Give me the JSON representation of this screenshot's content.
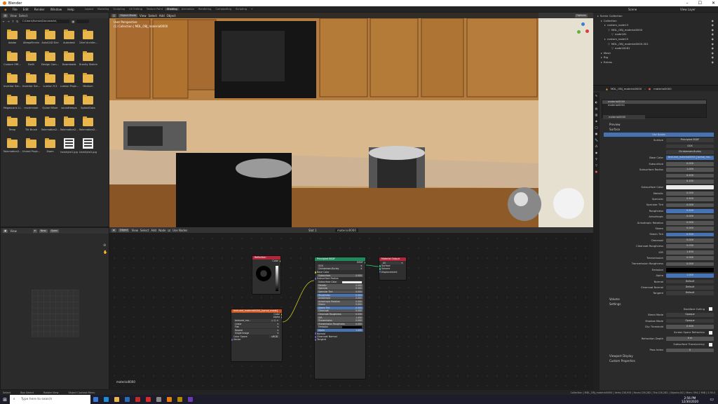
{
  "app": {
    "title": "Blender"
  },
  "menu": [
    "File",
    "Edit",
    "Render",
    "Window",
    "Help"
  ],
  "workspace_tabs": [
    "Layout",
    "Modeling",
    "Sculpting",
    "UV Editing",
    "Texture Paint",
    "Shading",
    "Animation",
    "Rendering",
    "Compositing",
    "Scripting"
  ],
  "active_workspace": "Shading",
  "scene": {
    "label": "Scene",
    "view_layer": "View Layer"
  },
  "file_browser": {
    "header": [
      "View",
      "Select"
    ],
    "path": "C:\\Users\\Human\\Documents\\",
    "items": [
      {
        "name": "Adobe",
        "kind": "folder"
      },
      {
        "name": "AlteqoFinmix",
        "kind": "folder"
      },
      {
        "name": "AutoCAD Dev",
        "kind": "folder"
      },
      {
        "name": "Autodesk",
        "kind": "folder"
      },
      {
        "name": "Chief Archite...",
        "kind": "folder"
      },
      {
        "name": "",
        "kind": "folder"
      },
      {
        "name": "Custom Offi...",
        "kind": "folder"
      },
      {
        "name": "Dalih",
        "kind": "folder"
      },
      {
        "name": "Design Com...",
        "kind": "folder"
      },
      {
        "name": "Downloads",
        "kind": "folder"
      },
      {
        "name": "Dravity Sketch",
        "kind": "folder"
      },
      {
        "name": "",
        "kind": "folder"
      },
      {
        "name": "Inventor Ser...",
        "kind": "folder"
      },
      {
        "name": "Inventor Ser...",
        "kind": "folder"
      },
      {
        "name": "Lumion 9.5",
        "kind": "folder"
      },
      {
        "name": "Lumion Proje...",
        "kind": "folder"
      },
      {
        "name": "Medium",
        "kind": "folder"
      },
      {
        "name": "",
        "kind": "folder"
      },
      {
        "name": "Megascans Li...",
        "kind": "folder"
      },
      {
        "name": "mushmixer",
        "kind": "folder"
      },
      {
        "name": "Quixel Mixer",
        "kind": "folder"
      },
      {
        "name": "soundtemps",
        "kind": "folder"
      },
      {
        "name": "SplashData",
        "kind": "folder"
      },
      {
        "name": "",
        "kind": "folder"
      },
      {
        "name": "Temp",
        "kind": "folder"
      },
      {
        "name": "Tilt Brush",
        "kind": "folder"
      },
      {
        "name": "Twinmotion2...",
        "kind": "folder"
      },
      {
        "name": "Twinmotion2...",
        "kind": "folder"
      },
      {
        "name": "Twinmotion2...",
        "kind": "folder"
      },
      {
        "name": "",
        "kind": "folder"
      },
      {
        "name": "Twinmotion2...",
        "kind": "folder"
      },
      {
        "name": "Unreal Proje...",
        "kind": "folder"
      },
      {
        "name": "Zoom",
        "kind": "folder"
      },
      {
        "name": "hamilyte1.jpg",
        "kind": "image"
      },
      {
        "name": "hamilyte2.jpg",
        "kind": "image"
      },
      {
        "name": "",
        "kind": "none"
      }
    ]
  },
  "image_editor": {
    "header": [
      "View"
    ],
    "buttons": [
      "New",
      "Open"
    ]
  },
  "viewport": {
    "header": [
      "Object Mode",
      "View",
      "Select",
      "Add",
      "Object"
    ],
    "info_line1": "User Perspective",
    "info_line2": "(1) Collection | MDL_OBJ_material0000",
    "options_label": "Options"
  },
  "node_editor": {
    "header": [
      "Object",
      "View",
      "Select",
      "Add",
      "Node",
      "Use Nodes"
    ],
    "slot": "Slot 1",
    "material": "material0000",
    "bottom_label": "material0000",
    "nodes": {
      "refraction": {
        "title": "Reflection",
        "out": "Color"
      },
      "image": {
        "title": "textured_material0000_[sprsql_mode]",
        "outs": [
          "Color",
          "Alpha"
        ],
        "file": "textured_ma...",
        "rows": [
          "Linear",
          "Flat",
          "Repeat",
          "Single Image"
        ],
        "color_space_label": "Color Space",
        "color_space": "sRGB",
        "vector": "Vector"
      },
      "bsdf": {
        "title": "Principled BSDF",
        "out": "BSDF",
        "dist": "GGX",
        "sss": "Christensen-Burley",
        "rows": [
          {
            "label": "Base Color",
            "value": "",
            "style": "socket"
          },
          {
            "label": "Subsurface",
            "value": "0.000",
            "style": "slider"
          },
          {
            "label": "Subsurface Radius",
            "value": "",
            "style": "socket"
          },
          {
            "label": "Subsurface Color",
            "value": "",
            "style": "white"
          },
          {
            "label": "Metallic",
            "value": "0.000",
            "style": "slider"
          },
          {
            "label": "Specular",
            "value": "0.500",
            "style": "slider"
          },
          {
            "label": "Specular Tint",
            "value": "0.000",
            "style": "slider"
          },
          {
            "label": "Roughness",
            "value": "0.500",
            "style": "blue"
          },
          {
            "label": "Anisotropic",
            "value": "0.000",
            "style": "slider"
          },
          {
            "label": "Anisotropic Rotation",
            "value": "0.000",
            "style": "slider"
          },
          {
            "label": "Sheen",
            "value": "0.000",
            "style": "slider"
          },
          {
            "label": "Sheen Tint",
            "value": "0.500",
            "style": "blue"
          },
          {
            "label": "Clearcoat",
            "value": "0.000",
            "style": "slider"
          },
          {
            "label": "Clearcoat Roughness",
            "value": "0.030",
            "style": "slider"
          },
          {
            "label": "IOR",
            "value": "1.450",
            "style": "slider"
          },
          {
            "label": "Transmission",
            "value": "0.000",
            "style": "slider"
          },
          {
            "label": "Transmission Roughness",
            "value": "0.000",
            "style": "slider"
          },
          {
            "label": "Emission",
            "value": "",
            "style": "black"
          },
          {
            "label": "Alpha",
            "value": "1.000",
            "style": "blue"
          },
          {
            "label": "Normal",
            "value": "",
            "style": "socket"
          },
          {
            "label": "Clearcoat Normal",
            "value": "",
            "style": "socket"
          },
          {
            "label": "Tangent",
            "value": "",
            "style": "socket"
          }
        ]
      },
      "output": {
        "title": "Material Output",
        "target": "All",
        "ins": [
          "Surface",
          "Volume",
          "Displacement"
        ]
      }
    }
  },
  "outliner": {
    "rows": [
      {
        "label": "Scene Collection",
        "indent": 0
      },
      {
        "label": "Collection",
        "indent": 1
      },
      {
        "label": "custom_node13",
        "indent": 2
      },
      {
        "label": "MDL_OBJ_material0000",
        "indent": 3
      },
      {
        "label": "node161",
        "indent": 4
      },
      {
        "label": "custom_node15",
        "indent": 2
      },
      {
        "label": "MDL_OBJ_material0000.001",
        "indent": 3
      },
      {
        "label": "node18181",
        "indent": 4
      },
      {
        "label": "Mesh",
        "indent": 1
      },
      {
        "label": "Rig",
        "indent": 1
      },
      {
        "label": "Extras",
        "indent": 1
      }
    ]
  },
  "properties": {
    "object": "MDL_OBJ_material0000",
    "material_tab": "material0000",
    "slots": [
      "material0000",
      "material0001"
    ],
    "material_field": "material0000",
    "sections": {
      "preview": "Preview",
      "surface": "Surface",
      "volume": "Volume",
      "settings": "Settings",
      "viewport_display": "Viewport Display",
      "custom_props": "Custom Properties"
    },
    "use_nodes": "Use Nodes",
    "surface_label": "Surface",
    "surface_value": "Principled BSDF",
    "dist": "GGX",
    "sss": "Christensen-Burley",
    "base_color_label": "Base Color",
    "base_color": "textured_material0000_[sprsql_mo...",
    "rows": [
      {
        "label": "Subsurface",
        "value": "0.000",
        "style": "plain"
      },
      {
        "label": "Subsurface Radius",
        "value": "1.000",
        "style": "plain"
      },
      {
        "label": "",
        "value": "0.200",
        "style": "plain"
      },
      {
        "label": "",
        "value": "0.100",
        "style": "plain"
      },
      {
        "label": "Subsurface Color",
        "value": "",
        "style": "white"
      },
      {
        "label": "Metallic",
        "value": "0.000",
        "style": "plain"
      },
      {
        "label": "Specular",
        "value": "0.500",
        "style": "plain"
      },
      {
        "label": "Specular Tint",
        "value": "0.000",
        "style": "plain"
      },
      {
        "label": "Roughness",
        "value": "0.500",
        "style": "blue"
      },
      {
        "label": "Anisotropic",
        "value": "0.000",
        "style": "plain"
      },
      {
        "label": "Anisotropic Rotation",
        "value": "0.000",
        "style": "plain"
      },
      {
        "label": "Sheen",
        "value": "0.000",
        "style": "plain"
      },
      {
        "label": "Sheen Tint",
        "value": "0.500",
        "style": "blue"
      },
      {
        "label": "Clearcoat",
        "value": "0.000",
        "style": "plain"
      },
      {
        "label": "Clearcoat Roughness",
        "value": "0.030",
        "style": "plain"
      },
      {
        "label": "IOR",
        "value": "1.450",
        "style": "plain"
      },
      {
        "label": "Transmission",
        "value": "0.000",
        "style": "plain"
      },
      {
        "label": "Transmission Roughness",
        "value": "0.000",
        "style": "plain"
      },
      {
        "label": "Emission",
        "value": "",
        "style": "black"
      },
      {
        "label": "Alpha",
        "value": "1.000",
        "style": "blue"
      },
      {
        "label": "Normal",
        "value": "Default",
        "style": "dark"
      },
      {
        "label": "Clearcoat Normal",
        "value": "Default",
        "style": "dark"
      },
      {
        "label": "Tangent",
        "value": "Default",
        "style": "dark"
      }
    ],
    "settings_rows": [
      {
        "label": "",
        "value": "Backface Culling",
        "style": "check"
      },
      {
        "label": "Blend Mode",
        "value": "Opaque",
        "style": "dark"
      },
      {
        "label": "Shadow Mode",
        "value": "Opaque",
        "style": "dark"
      },
      {
        "label": "Clip Threshold",
        "value": "0.500",
        "style": "plain"
      },
      {
        "label": "",
        "value": "Screen Space Refraction",
        "style": "check"
      },
      {
        "label": "Refraction Depth",
        "value": "0 m",
        "style": "plain"
      },
      {
        "label": "",
        "value": "Subsurface Translucency",
        "style": "check"
      },
      {
        "label": "Pass Index",
        "value": "0",
        "style": "plain"
      }
    ]
  },
  "status": {
    "left": [
      "Select",
      "Box Select",
      "Rotate View",
      "Object Context Menu"
    ],
    "right": "Collection | MDL_OBJ_material0000 | Verts:138,934 | Faces:126,282 | Tris:126,282 | Objects:0/2 | Mem: 594.2 MiB | 2.90.0"
  },
  "taskbar": {
    "search": "Type here to search",
    "time": "2:56 PM",
    "date": "12/30/2020"
  },
  "colors": {
    "accent": "#4772b3",
    "folder": "#e9b64b",
    "bsdf_header": "#1f8a5b",
    "output_header": "#b3253a",
    "image_header": "#c8531f",
    "refl_header": "#b3253a"
  }
}
